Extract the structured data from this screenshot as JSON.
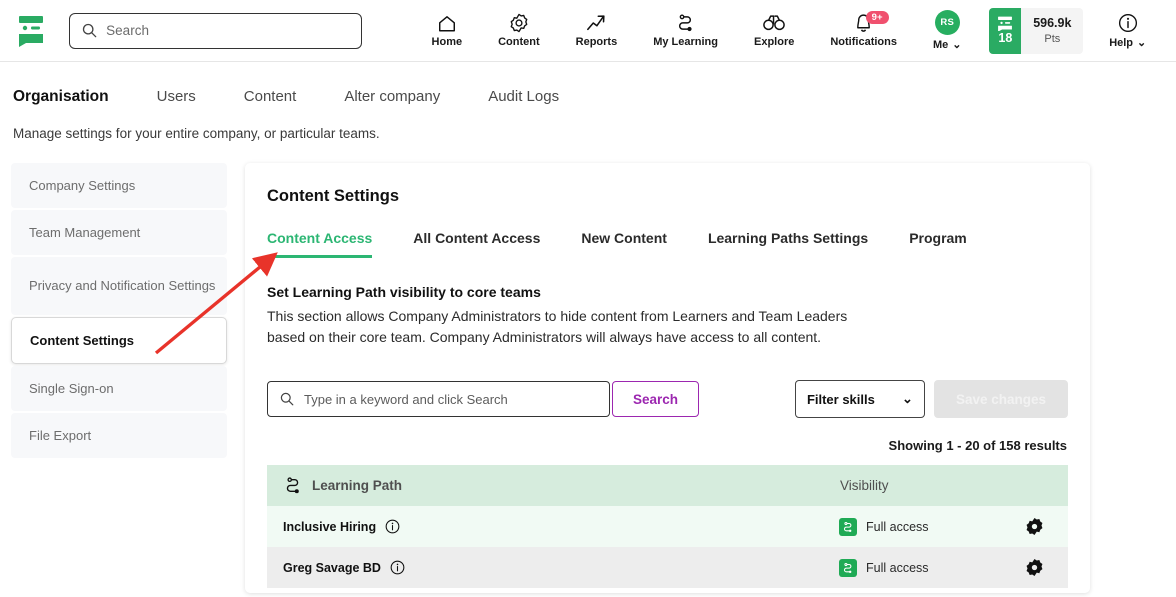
{
  "brand": {
    "logo_icon": "speech-bubble-logo",
    "green": "#2cb673",
    "purple": "#9c27b0",
    "red_arrow": "#e8332a"
  },
  "topbar": {
    "search": {
      "placeholder": "Search",
      "icon": "search-icon"
    },
    "nav": [
      {
        "label": "Home",
        "icon": "home-icon"
      },
      {
        "label": "Content",
        "icon": "gear-icon"
      },
      {
        "label": "Reports",
        "icon": "trending-arrow-icon"
      },
      {
        "label": "My Learning",
        "icon": "learning-path-icon"
      },
      {
        "label": "Explore",
        "icon": "binoculars-icon"
      },
      {
        "label": "Notifications",
        "icon": "bell-icon",
        "badge": "9+"
      }
    ],
    "me": {
      "label": "Me",
      "initials": "RS",
      "caret": "⌄"
    },
    "points": {
      "level": "18",
      "value": "596.9k",
      "unit": "Pts",
      "icon": "speech-bubble-logo"
    },
    "help": {
      "label": "Help",
      "icon": "info-icon",
      "caret": "⌄"
    }
  },
  "section_tabs": [
    {
      "label": "Organisation",
      "active": true
    },
    {
      "label": "Users",
      "active": false
    },
    {
      "label": "Content",
      "active": false
    },
    {
      "label": "Alter company",
      "active": false
    },
    {
      "label": "Audit Logs",
      "active": false
    }
  ],
  "subtitle": "Manage settings for your entire company, or particular teams.",
  "sidebar": {
    "items": [
      {
        "label": "Company Settings",
        "active": false
      },
      {
        "label": "Team Management",
        "active": false
      },
      {
        "label": "Privacy and Notification Settings",
        "active": false
      },
      {
        "label": "Content Settings",
        "active": true
      },
      {
        "label": "Single Sign-on",
        "active": false
      },
      {
        "label": "File Export",
        "active": false
      }
    ]
  },
  "card": {
    "title": "Content Settings",
    "tabs": [
      {
        "label": "Content Access",
        "active": true
      },
      {
        "label": "All Content Access",
        "active": false
      },
      {
        "label": "New Content",
        "active": false
      },
      {
        "label": "Learning Paths Settings",
        "active": false
      },
      {
        "label": "Program",
        "active": false
      }
    ],
    "block_title": "Set Learning Path visibility to core teams",
    "block_text": "This section allows Company Administrators to hide content from Learners and Team Leaders based on their core team. Company Administrators will always have access to all content.",
    "keyword_input": {
      "placeholder": "Type in a keyword and click Search",
      "value": "",
      "icon": "search-icon"
    },
    "search_button": "Search",
    "filter_select": {
      "label": "Filter skills",
      "caret": "⌄"
    },
    "save_button": "Save changes",
    "showing": "Showing 1 - 20 of 158 results",
    "table": {
      "columns": {
        "name": "Learning Path",
        "visibility": "Visibility",
        "name_icon": "learning-path-icon"
      },
      "rows": [
        {
          "name": "Inclusive Hiring",
          "info_icon": "info-icon",
          "visibility": "Full access",
          "badge_icon": "learning-path-icon",
          "gear_icon": "gear-icon"
        },
        {
          "name": "Greg Savage BD",
          "info_icon": "info-icon",
          "visibility": "Full access",
          "badge_icon": "learning-path-icon",
          "gear_icon": "gear-icon"
        }
      ]
    }
  }
}
